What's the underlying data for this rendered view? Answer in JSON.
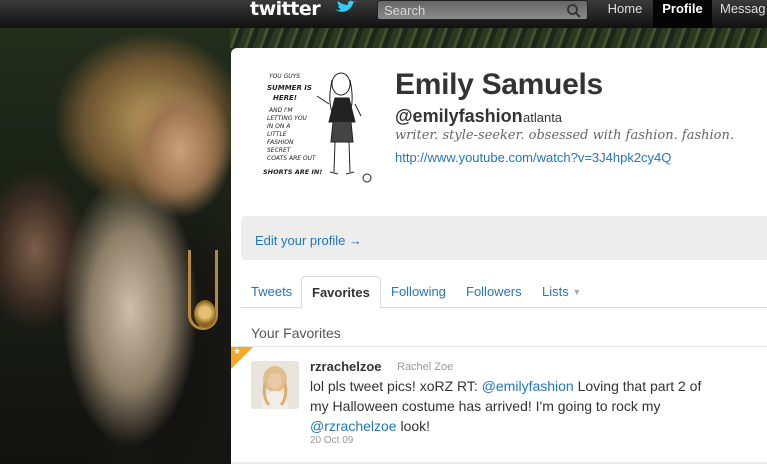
{
  "topbar": {
    "logo_text": "twitter",
    "search_placeholder": "Search",
    "nav": {
      "home": "Home",
      "profile": "Profile",
      "messages": "Messag"
    }
  },
  "profile": {
    "name": "Emily Samuels",
    "handle": "@emilyfashion",
    "location": "atlanta",
    "bio": "writer. style-seeker. obsessed with fashion. fashion.",
    "url": "http://www.youtube.com/watch?v=3J4hpk2cy4Q",
    "edit_link": "Edit your profile →",
    "avatar_text": [
      "YOU GUYS",
      "SUMMER IS",
      "HERE!",
      "SHORTS ARE IN!"
    ]
  },
  "tabs": [
    {
      "label": "Tweets"
    },
    {
      "label": "Favorites"
    },
    {
      "label": "Following"
    },
    {
      "label": "Followers"
    },
    {
      "label": "Lists"
    }
  ],
  "favorites": {
    "title": "Your Favorites",
    "items": [
      {
        "username": "rzrachelzoe",
        "realname": "Rachel Zoe",
        "text_1": "lol pls tweet pics! xoRZ RT: ",
        "mention_1": "@emilyfashion",
        "text_2": " Loving that part 2 of my Halloween costume has arrived! I'm going to rock my ",
        "mention_2": "@rzrachelzoe",
        "text_3": " look!",
        "date": "20 Oct 09"
      }
    ]
  },
  "colors": {
    "link": "#2276bb",
    "star": "#f5a623",
    "topbar": "#111111"
  }
}
